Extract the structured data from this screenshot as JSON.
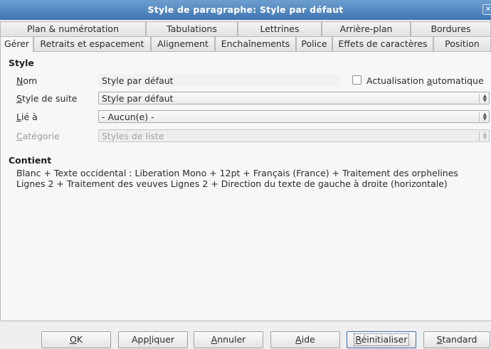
{
  "window": {
    "title": "Style de paragraphe: Style par défaut",
    "close_glyph": "✕"
  },
  "tabs_row1": [
    {
      "label": "Plan & numérotation"
    },
    {
      "label": "Tabulations"
    },
    {
      "label": "Lettrines"
    },
    {
      "label": "Arrière-plan"
    },
    {
      "label": "Bordures"
    }
  ],
  "tabs_row2": [
    {
      "label": "Gérer"
    },
    {
      "label": "Retraits et espacement"
    },
    {
      "label": "Alignement"
    },
    {
      "label": "Enchaînements"
    },
    {
      "label": "Police"
    },
    {
      "label": "Effets de caractères"
    },
    {
      "label": "Position"
    }
  ],
  "style_section": {
    "title": "Style",
    "name": {
      "label_u": "N",
      "label_rest": "om",
      "value": "Style par défaut"
    },
    "auto_update": {
      "label_pre": "Actualisation ",
      "label_u": "a",
      "label_post": "utomatique",
      "checked": false
    },
    "next_style": {
      "label_u": "S",
      "label_rest": "tyle de suite",
      "value": "Style par défaut"
    },
    "linked_to": {
      "label_u": "L",
      "label_rest": "ié à",
      "value": "- Aucun(e) -"
    },
    "category": {
      "label_u": "C",
      "label_rest": "atégorie",
      "value": "Styles de liste"
    }
  },
  "contains_section": {
    "title": "Contient",
    "line1": "Blanc + Texte occidental : Liberation Mono + 12pt + Français (France) + Traitement des orphelines",
    "line2": "Lignes 2 + Traitement des veuves Lignes 2 + Direction du texte de gauche à droite (horizontale)"
  },
  "buttons": {
    "ok": {
      "label_u": "O",
      "label_rest": "K"
    },
    "apply": {
      "label_pre": "App",
      "label_u": "l",
      "label_post": "iquer"
    },
    "cancel": {
      "label_u": "A",
      "label_rest": "nnuler"
    },
    "help": {
      "label_u": "A",
      "label_rest": "ide"
    },
    "reset": {
      "label_u": "R",
      "label_rest": "éinitialiser"
    },
    "standard": {
      "label_u": "S",
      "label_rest": "tandard"
    }
  },
  "spin_glyphs": {
    "up": "▲",
    "down": "▼"
  },
  "colors": {
    "titlebar": "#4f86c2",
    "focus_border": "#3c6fb0"
  }
}
